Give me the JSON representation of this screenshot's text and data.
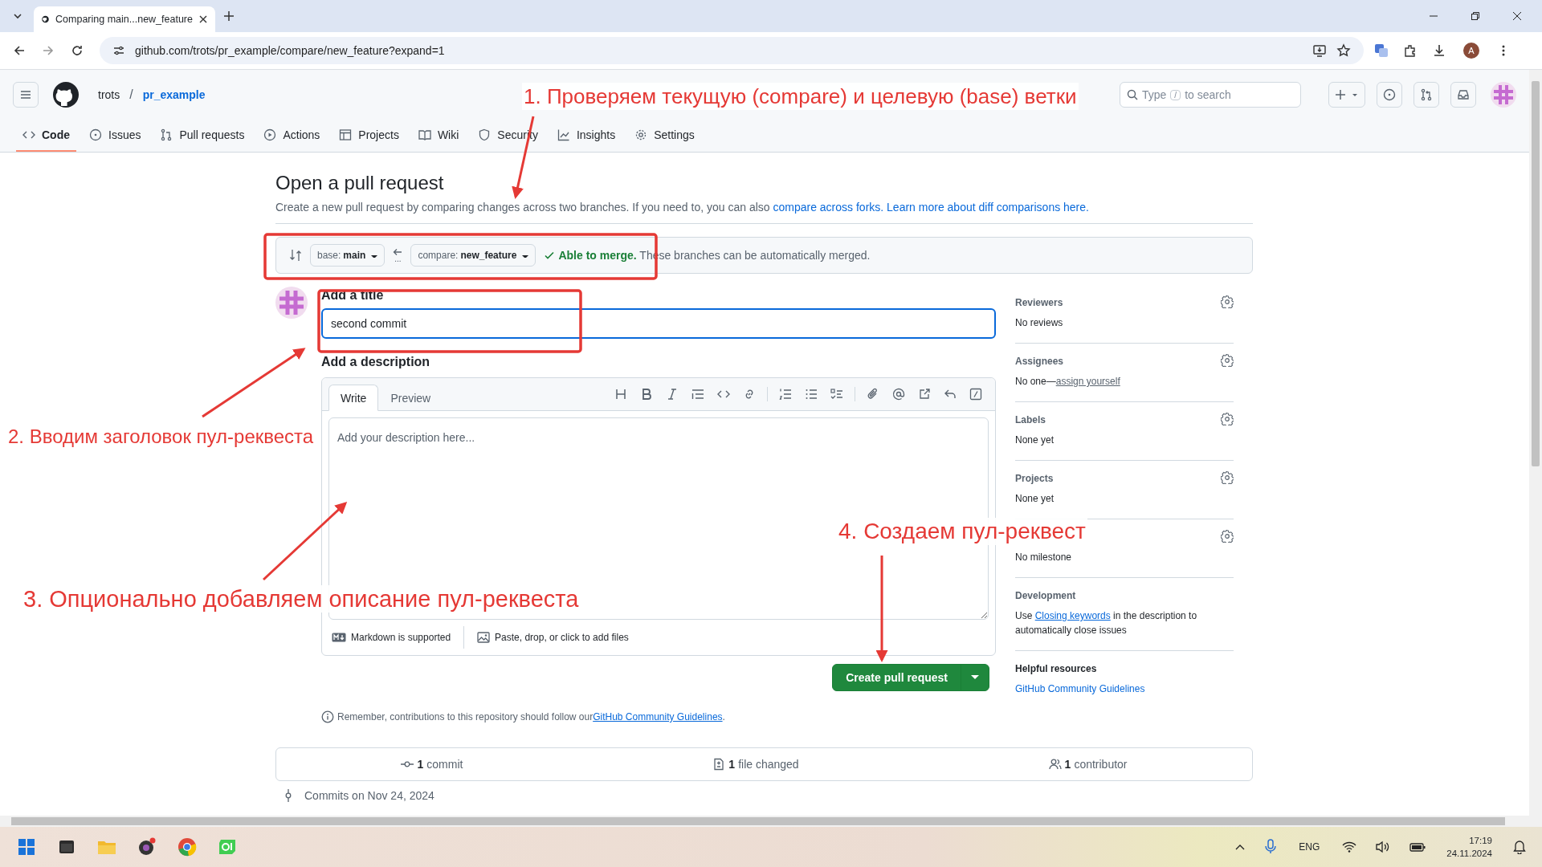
{
  "browser": {
    "tab_title": "Comparing main...new_feature",
    "url": "github.com/trots/pr_example/compare/new_feature?expand=1",
    "profile_initial": "A"
  },
  "repo": {
    "owner": "trots",
    "separator": "/",
    "name": "pr_example"
  },
  "search": {
    "placeholder_before": "Type",
    "key": "/",
    "placeholder_after": "to search"
  },
  "nav_tabs": [
    {
      "label": "Code",
      "selected": true
    },
    {
      "label": "Issues",
      "selected": false
    },
    {
      "label": "Pull requests",
      "selected": false
    },
    {
      "label": "Actions",
      "selected": false
    },
    {
      "label": "Projects",
      "selected": false
    },
    {
      "label": "Wiki",
      "selected": false
    },
    {
      "label": "Security",
      "selected": false
    },
    {
      "label": "Insights",
      "selected": false
    },
    {
      "label": "Settings",
      "selected": false
    }
  ],
  "page": {
    "title": "Open a pull request",
    "subtitle": "Create a new pull request by comparing changes across two branches. If you need to, you can also ",
    "link_1": "compare across forks.",
    "link_2": "Learn more about diff comparisons here."
  },
  "compare": {
    "base_prefix": "base:",
    "base": "main",
    "compare_prefix": "compare:",
    "compare": "new_feature",
    "dots": "...",
    "merge_status": "Able to merge.",
    "merge_note": "These branches can be automatically merged."
  },
  "form": {
    "title_label": "Add a title",
    "title_value": "second commit",
    "description_label": "Add a description",
    "editor_tabs": [
      {
        "label": "Write",
        "selected": true
      },
      {
        "label": "Preview",
        "selected": false
      }
    ],
    "placeholder": "Add your description here...",
    "markdown_note": "Markdown is supported",
    "attach_note": "Paste, drop, or click to add files",
    "submit": "Create pull request"
  },
  "remember": {
    "text": "Remember, contributions to this repository should follow our ",
    "link": "GitHub Community Guidelines",
    "end": "."
  },
  "sidebar": [
    {
      "kind": "setting",
      "heading": "Reviewers",
      "body": [
        {
          "text": "No reviews"
        }
      ]
    },
    {
      "kind": "setting",
      "heading": "Assignees",
      "body": [
        {
          "text": "No one—"
        },
        {
          "link": "assign yourself"
        }
      ]
    },
    {
      "kind": "setting",
      "heading": "Labels",
      "body": [
        {
          "text": "None yet"
        }
      ]
    },
    {
      "kind": "setting",
      "heading": "Projects",
      "body": [
        {
          "text": "None yet"
        }
      ]
    },
    {
      "kind": "setting",
      "body": [
        {
          "text": "No milestone"
        }
      ]
    },
    {
      "kind": "info",
      "heading": "Development",
      "body": [
        {
          "text": "Use "
        },
        {
          "link": "Closing keywords"
        },
        {
          "text": " in the description to automatically close issues"
        }
      ]
    },
    {
      "kind": "resources",
      "heading": "Helpful resources",
      "body": [
        {
          "link": "GitHub Community Guidelines"
        }
      ]
    }
  ],
  "stats": [
    {
      "kind": "commit",
      "count": "1",
      "label": "commit"
    },
    {
      "kind": "file",
      "count": "1",
      "label": "file changed"
    },
    {
      "kind": "people",
      "count": "1",
      "label": "contributor"
    }
  ],
  "commits_heading": "Commits on Nov 24, 2024",
  "taskbar": {
    "language": "ENG",
    "time": "17:19",
    "date": "24.11.2024"
  },
  "annotations": [
    {
      "text": "1. Проверяем текущую (compare) и целевую (base) ветки"
    },
    {
      "text": "2. Вводим заголовок пул-реквеста"
    },
    {
      "text": "3. Опционально добавляем описание пул-реквеста"
    },
    {
      "text": "4. Создаем пул-реквест"
    }
  ]
}
